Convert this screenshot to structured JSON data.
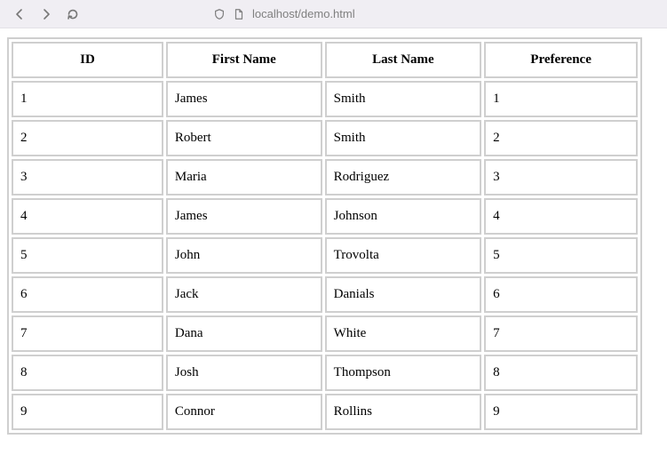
{
  "browser": {
    "url": "localhost/demo.html"
  },
  "table": {
    "headers": [
      "ID",
      "First Name",
      "Last Name",
      "Preference"
    ],
    "rows": [
      {
        "id": "1",
        "first": "James",
        "last": "Smith",
        "pref": "1"
      },
      {
        "id": "2",
        "first": "Robert",
        "last": "Smith",
        "pref": "2"
      },
      {
        "id": "3",
        "first": "Maria",
        "last": "Rodriguez",
        "pref": "3"
      },
      {
        "id": "4",
        "first": "James",
        "last": "Johnson",
        "pref": "4"
      },
      {
        "id": "5",
        "first": "John",
        "last": "Trovolta",
        "pref": "5"
      },
      {
        "id": "6",
        "first": "Jack",
        "last": "Danials",
        "pref": "6"
      },
      {
        "id": "7",
        "first": "Dana",
        "last": "White",
        "pref": "7"
      },
      {
        "id": "8",
        "first": "Josh",
        "last": "Thompson",
        "pref": "8"
      },
      {
        "id": "9",
        "first": "Connor",
        "last": "Rollins",
        "pref": "9"
      }
    ]
  }
}
